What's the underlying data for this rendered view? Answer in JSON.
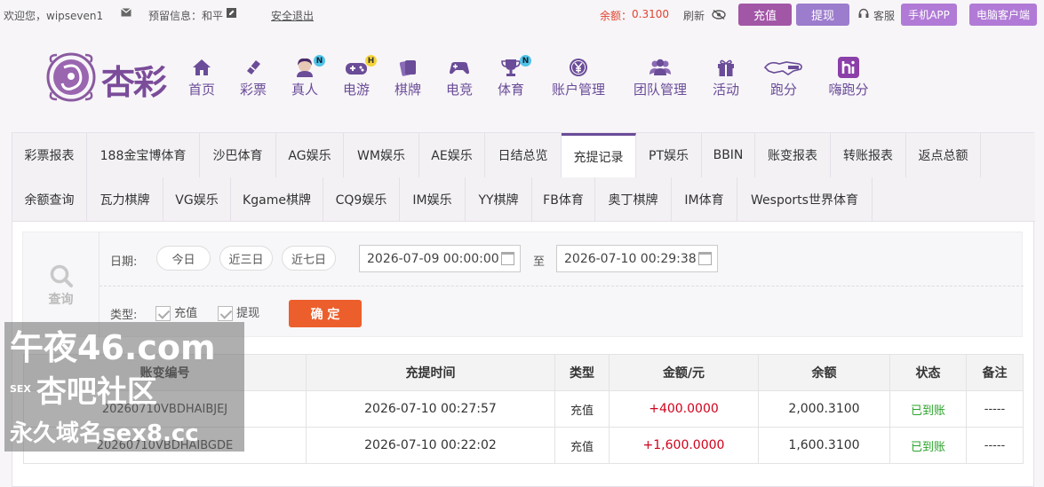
{
  "topbar": {
    "welcome": "欢迎您，wipseven1",
    "reserved_info": "预留信息：和平",
    "logout": "安全退出",
    "balance_label": "余额：",
    "balance_value": "0.3100",
    "refresh": "刷新",
    "deposit": "充值",
    "withdraw": "提现",
    "service": "客服",
    "mobile_app": "手机APP",
    "pc_client": "电脑客户端"
  },
  "logo": {
    "text": "杏彩"
  },
  "nav": [
    {
      "label": "首页",
      "icon": "home-icon"
    },
    {
      "label": "彩票",
      "icon": "ticket-icon"
    },
    {
      "label": "真人",
      "icon": "dealer-icon",
      "badge": "N"
    },
    {
      "label": "电游",
      "icon": "gamepad-icon",
      "badge": "H"
    },
    {
      "label": "棋牌",
      "icon": "cards-icon"
    },
    {
      "label": "电竞",
      "icon": "controller-icon"
    },
    {
      "label": "体育",
      "icon": "trophy-icon",
      "badge": "N"
    },
    {
      "label": "账户管理",
      "icon": "yen-coin-icon"
    },
    {
      "label": "团队管理",
      "icon": "team-icon"
    },
    {
      "label": "活动",
      "icon": "gift-icon"
    },
    {
      "label": "跑分",
      "icon": "runner-icon"
    },
    {
      "label": "嗨跑分",
      "icon": "hi-icon"
    }
  ],
  "tabs_row1": [
    "彩票报表",
    "188金宝博体育",
    "沙巴体育",
    "AG娱乐",
    "WM娱乐",
    "AE娱乐",
    "日结总览",
    "充提记录",
    "PT娱乐",
    "BBIN",
    "账变报表",
    "转账报表",
    "返点总额"
  ],
  "tabs_row2": [
    "余额查询",
    "瓦力棋牌",
    "VG娱乐",
    "Kgame棋牌",
    "CQ9娱乐",
    "IM娱乐",
    "YY棋牌",
    "FB体育",
    "奥丁棋牌",
    "IM体育",
    "Wesports世界体育"
  ],
  "active_tab": "充提记录",
  "filter": {
    "query_label": "查询",
    "date_label": "日期:",
    "today": "今日",
    "last3": "近三日",
    "last7": "近七日",
    "from": "2026-07-09 00:00:00",
    "to_label": "至",
    "to": "2026-07-10 00:29:38",
    "type_label": "类型:",
    "opt_deposit": "充值",
    "opt_withdraw": "提现",
    "confirm": "确 定"
  },
  "table": {
    "headers": [
      "账变编号",
      "充提时间",
      "类型",
      "金额/元",
      "余额",
      "状态",
      "备注"
    ],
    "rows": [
      [
        "20260710VBDHAIBJEJ",
        "2026-07-10 00:27:57",
        "充值",
        "+400.0000",
        "2,000.3100",
        "已到账",
        "-----"
      ],
      [
        "20260710VBDHAIBGDE",
        "2026-07-10 00:22:02",
        "充值",
        "+1,600.0000",
        "1,600.3100",
        "已到账",
        "-----"
      ]
    ]
  },
  "watermark": {
    "line1": "午夜46.com",
    "line2": "杏吧社区",
    "line2_side": "SEX",
    "line3": "永久域名sex8.cc"
  },
  "colors": {
    "brand": "#6a4c98",
    "deposit_btn": "#a256a6",
    "withdraw_btn": "#9c7ccd",
    "confirm_btn": "#ec5f2c",
    "amount_red": "#d0021b",
    "status_green": "#2aa32a",
    "balance_orange": "#e0442f"
  }
}
